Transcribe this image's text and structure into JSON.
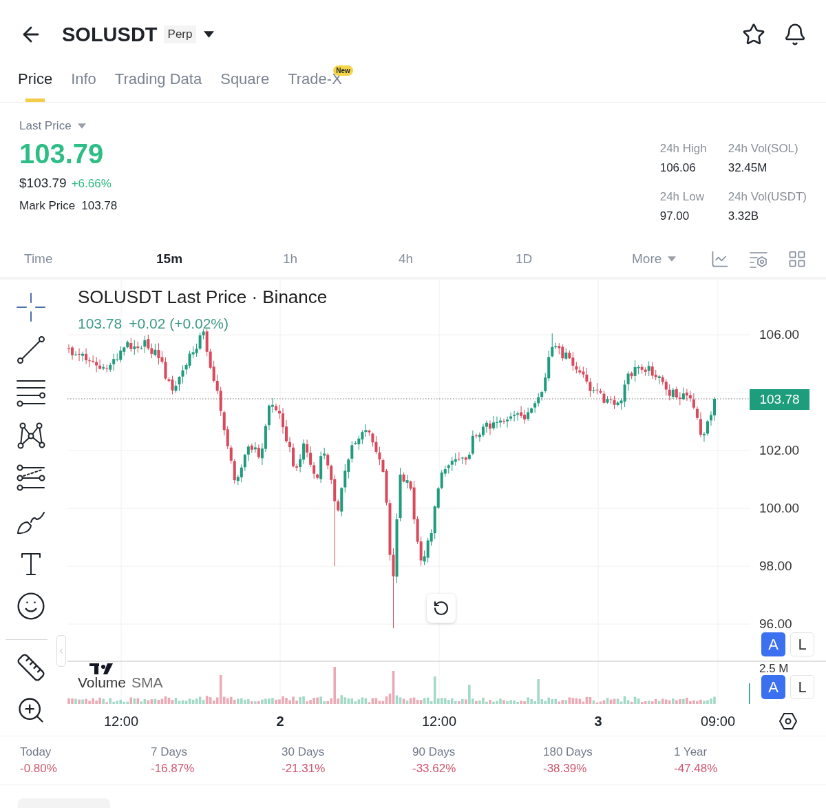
{
  "header": {
    "symbol": "SOLUSDT",
    "badge": "Perp"
  },
  "tabs": [
    {
      "label": "Price",
      "selected": true
    },
    {
      "label": "Info",
      "selected": false
    },
    {
      "label": "Trading Data",
      "selected": false
    },
    {
      "label": "Square",
      "selected": false
    },
    {
      "label": "Trade-X",
      "selected": false,
      "badge": "New"
    }
  ],
  "price_panel": {
    "selector": "Last Price",
    "last_price": "103.79",
    "usd_price": "$103.79",
    "change": "+6.66%",
    "mark_label": "Mark Price",
    "mark_price": "103.78",
    "stats": [
      {
        "label": "24h High",
        "value": "106.06"
      },
      {
        "label": "24h Vol(SOL)",
        "value": "32.45M"
      },
      {
        "label": "24h Low",
        "value": "97.00"
      },
      {
        "label": "24h Vol(USDT)",
        "value": "3.32B"
      }
    ]
  },
  "intervals": [
    {
      "label": "Time",
      "selected": false
    },
    {
      "label": "15m",
      "selected": true
    },
    {
      "label": "1h",
      "selected": false
    },
    {
      "label": "4h",
      "selected": false
    },
    {
      "label": "1D",
      "selected": false
    }
  ],
  "more": {
    "label": "More"
  },
  "chart": {
    "title": "SOLUSDT Last Price · Binance",
    "last": "103.78",
    "change": "+0.02 (+0.02%)",
    "price_axis": [
      "106.00",
      "102.00",
      "100.00",
      "98.00",
      "96.00"
    ],
    "price_tag": "103.78",
    "scale_buttons": [
      {
        "label": "A",
        "selected": true
      },
      {
        "label": "L",
        "selected": false
      }
    ],
    "volume": {
      "title": "Volume",
      "indicator": "SMA",
      "axis_label": "2.5 M",
      "scale_buttons": [
        {
          "label": "A",
          "selected": true
        },
        {
          "label": "L",
          "selected": false
        }
      ]
    },
    "time_axis": [
      {
        "label": "12:00",
        "kind": "time"
      },
      {
        "label": "2",
        "kind": "day"
      },
      {
        "label": "12:00",
        "kind": "time"
      },
      {
        "label": "3",
        "kind": "day"
      },
      {
        "label": "09:00",
        "kind": "time"
      }
    ]
  },
  "performance": [
    {
      "period": "Today",
      "change": "-0.80%"
    },
    {
      "period": "7 Days",
      "change": "-16.87%"
    },
    {
      "period": "30 Days",
      "change": "-21.31%"
    },
    {
      "period": "90 Days",
      "change": "-33.62%"
    },
    {
      "period": "180 Days",
      "change": "-38.39%"
    },
    {
      "period": "1 Year",
      "change": "-47.48%"
    }
  ]
}
